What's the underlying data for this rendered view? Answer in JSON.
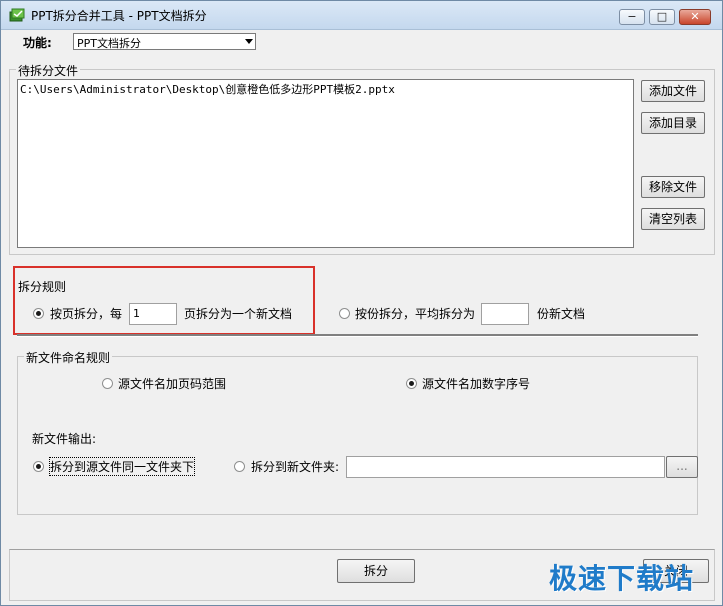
{
  "window": {
    "title": "PPT拆分合并工具 - PPT文档拆分",
    "min_glyph": "−",
    "max_glyph": "□",
    "close_glyph": "✕",
    "app_icon": "ppt-tool-icon"
  },
  "function": {
    "label": "功能:",
    "selected": "PPT文档拆分"
  },
  "files_group": {
    "title": "待拆分文件",
    "items": [
      "C:\\Users\\Administrator\\Desktop\\创意橙色低多边形PPT模板2.pptx"
    ],
    "buttons": {
      "add_file": "添加文件",
      "add_dir": "添加目录",
      "remove_file": "移除文件",
      "clear_list": "清空列表"
    }
  },
  "split_rule": {
    "title": "拆分规则",
    "by_page_label": "按页拆分，每",
    "by_page_value": "1",
    "by_page_suffix": "页拆分为一个新文档",
    "by_count_label": "按份拆分，平均拆分为",
    "by_count_value": "",
    "by_count_suffix": "份新文档",
    "selected": "by_page"
  },
  "naming": {
    "title": "新文件命名规则",
    "option_page_range": "源文件名加页码范围",
    "option_number_seq": "源文件名加数字序号",
    "selected": "number_seq"
  },
  "output": {
    "label": "新文件输出:",
    "same_folder": "拆分到源文件同一文件夹下",
    "new_folder": "拆分到新文件夹:",
    "folder_value": "",
    "browse_label": "...",
    "selected": "same_folder"
  },
  "actions": {
    "split": "拆分",
    "close": "关闭"
  },
  "watermark": "极速下载站",
  "colors": {
    "highlight": "#d9312a",
    "watermark": "#1f7bc9"
  }
}
